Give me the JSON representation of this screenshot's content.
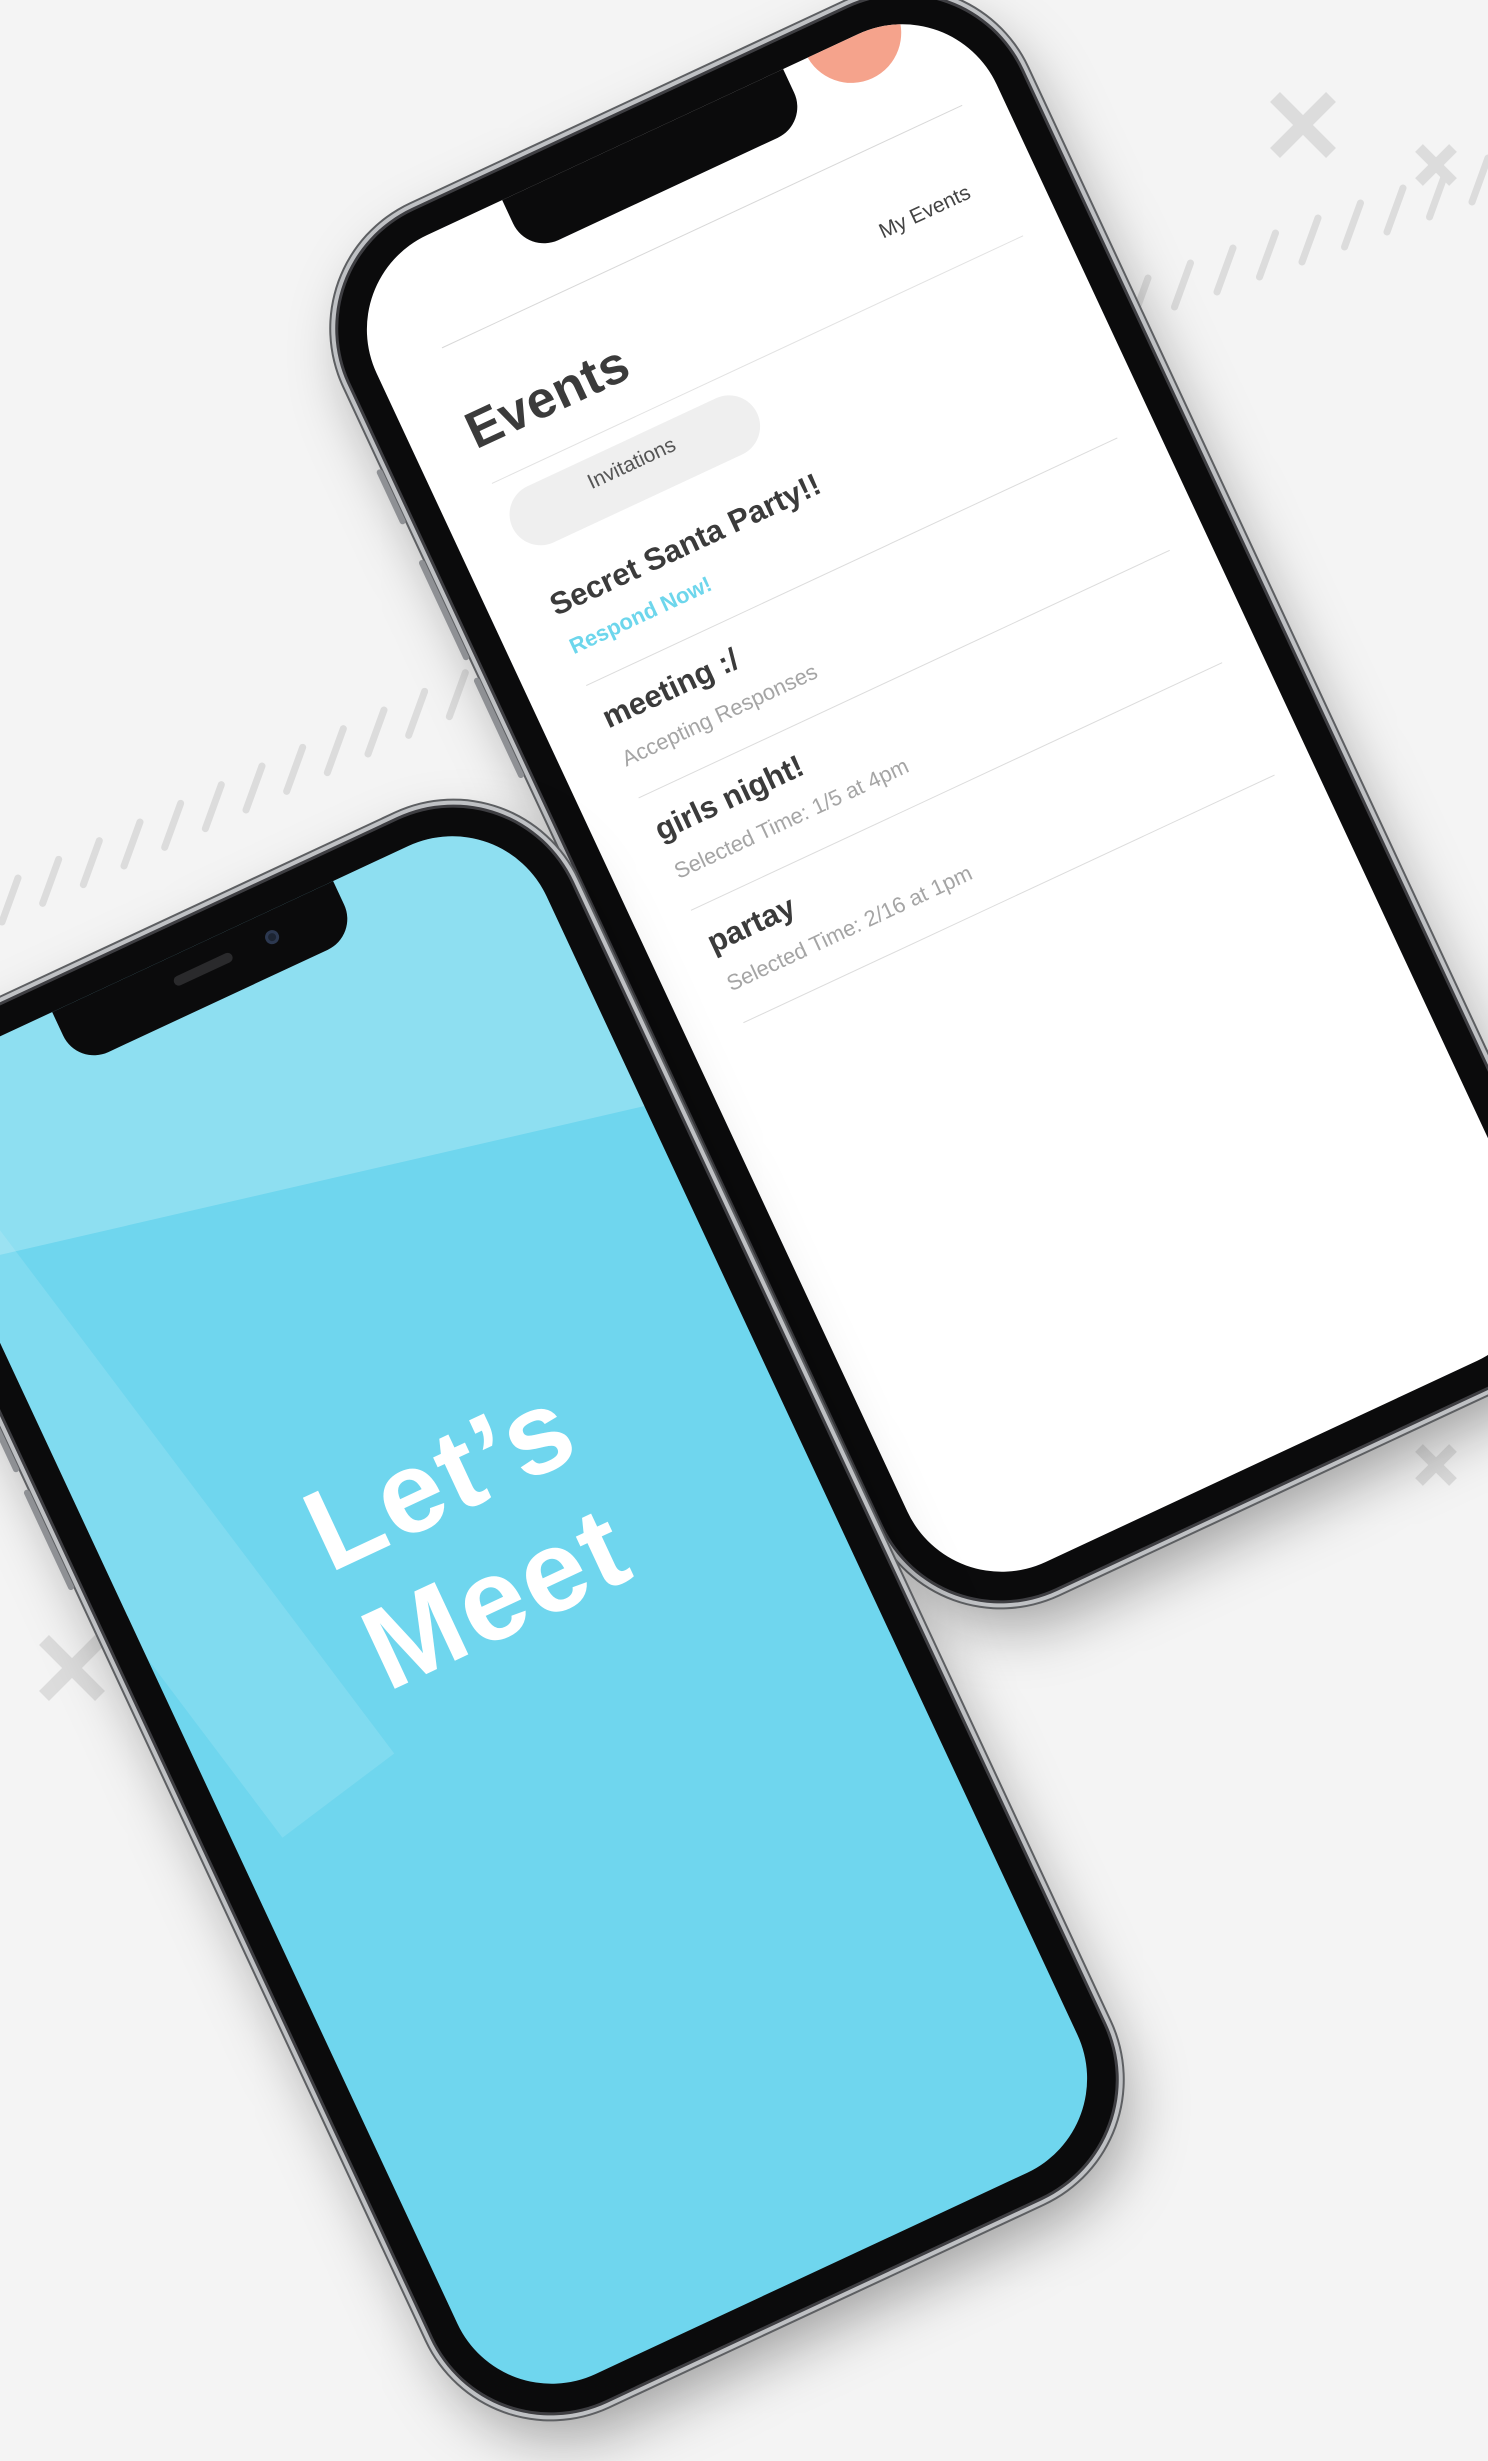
{
  "events_screen": {
    "title": "Events",
    "tab_my_events": "My Events",
    "tab_invitations": "Invitations",
    "events": [
      {
        "name": "Secret Santa Party!!",
        "status": "Respond Now!",
        "highlight": true
      },
      {
        "name": "meeting :/",
        "status": "Accepting Responses",
        "highlight": false
      },
      {
        "name": "girls night!",
        "status": "Selected Time: 1/5 at 4pm",
        "highlight": false
      },
      {
        "name": "partay",
        "status": "Selected Time: 2/16 at 1pm",
        "highlight": false
      }
    ]
  },
  "splash_screen": {
    "line1": "Let’s",
    "line2": "Meet"
  },
  "colors": {
    "background": "#f4f4f4",
    "accent": "#6dd6ec",
    "splash_bg": "#6fd6ee",
    "dot": "#f5a38c",
    "decor": "#dcdcdc"
  }
}
